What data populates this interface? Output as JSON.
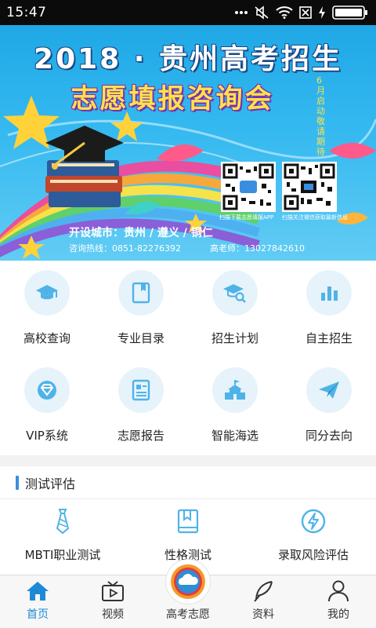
{
  "status_bar": {
    "time": "15:47"
  },
  "banner": {
    "title": "2018 · 贵州高考招生",
    "subtitle": "志愿填报咨询会",
    "date_vertical": "6月启动 敬请期待",
    "qr1_caption": "扫描下载志愿填报APP",
    "qr2_caption": "扫描关注微信获取最新信息",
    "cities": "开设城市：贵州 / 遵义 / 铜仁",
    "hotline": "咨询热线：0851-82276392",
    "teacher": "高老师：13027842610"
  },
  "grid": [
    {
      "label": "高校查询",
      "icon": "graduation-cap-icon"
    },
    {
      "label": "专业目录",
      "icon": "book-icon"
    },
    {
      "label": "招生计划",
      "icon": "cap-search-icon"
    },
    {
      "label": "自主招生",
      "icon": "bar-chart-icon"
    },
    {
      "label": "VIP系统",
      "icon": "diamond-icon"
    },
    {
      "label": "志愿报告",
      "icon": "report-icon"
    },
    {
      "label": "智能海选",
      "icon": "school-building-icon"
    },
    {
      "label": "同分去向",
      "icon": "paper-plane-icon"
    }
  ],
  "section": {
    "title": "测试评估"
  },
  "tests": [
    {
      "label": "MBTI职业测试",
      "icon": "tie-icon"
    },
    {
      "label": "性格测试",
      "icon": "notebook-icon"
    },
    {
      "label": "录取风险评估",
      "icon": "lightning-icon"
    }
  ],
  "bottom_nav": [
    {
      "label": "首页",
      "icon": "home-icon",
      "active": true
    },
    {
      "label": "视频",
      "icon": "tv-icon",
      "active": false
    },
    {
      "label": "高考志愿",
      "icon": "cloud-logo-icon",
      "active": false
    },
    {
      "label": "资料",
      "icon": "feather-icon",
      "active": false
    },
    {
      "label": "我的",
      "icon": "user-icon",
      "active": false
    }
  ],
  "colors": {
    "accent": "#1e8ad6",
    "icon_blue": "#4fb3e8",
    "icon_bg": "#e6f3fb"
  }
}
